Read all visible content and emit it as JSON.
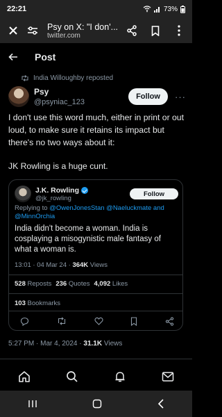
{
  "status": {
    "time": "22:21",
    "battery": "73%"
  },
  "browser": {
    "title": "Psy on X: \"I don'...",
    "url": "twitter.com"
  },
  "page": {
    "title": "Post"
  },
  "repost": {
    "text": "India Willoughby reposted"
  },
  "author": {
    "display_name": "Psy",
    "handle": "@psyniac_123",
    "follow_label": "Follow"
  },
  "post": {
    "paragraph1": "I don't use this word much, either in print or out loud, to make sure it retains its impact but there's no two ways about it:",
    "paragraph2": "JK Rowling is a huge cunt.",
    "timestamp": "5:27 PM · Mar 4, 2024 ·",
    "views_count": "31.1K",
    "views_label": "Views"
  },
  "quote": {
    "display_name": "J.K. Rowling",
    "handle": "@jk_rowling",
    "follow_label": "Follow",
    "replying_prefix": "Replying to",
    "reply_handle1": "@OwenJonesStan",
    "reply_handle2": "@Naeluckmate",
    "reply_and": "and",
    "reply_handle3": "@MinnOrchia",
    "text": "India didn't become a woman. India is cosplaying a misogynistic male fantasy of what a woman is.",
    "timestamp": "13:01 · 04 Mar 24 ·",
    "views_count": "364K",
    "views_label": "Views",
    "reposts_count": "528",
    "reposts_label": "Reposts",
    "quotes_count": "236",
    "quotes_label": "Quotes",
    "likes_count": "4,092",
    "likes_label": "Likes",
    "bookmarks_count": "103",
    "bookmarks_label": "Bookmarks"
  },
  "colors": {
    "accent": "#1d9bf0",
    "background": "#000000",
    "muted": "#8b98a5"
  }
}
